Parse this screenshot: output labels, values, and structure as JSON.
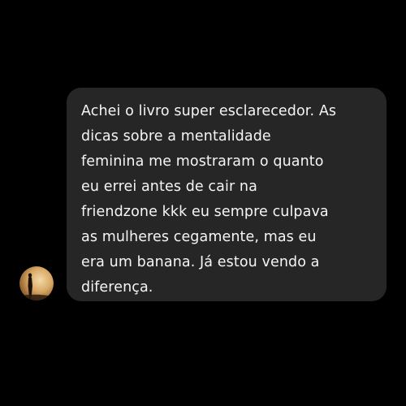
{
  "chat": {
    "avatar_icon": "user-avatar-silhouette-sunset",
    "bubble_color": "#262626",
    "background_color": "#000000",
    "text_color": "#f5f5f5",
    "message": {
      "text": "Achei o livro super esclarecedor. As\ndicas sobre a mentalidade\nfeminina me mostraram o quanto\neu errei antes de cair na\nfriendzone kkk eu sempre culpava\nas mulheres cegamente, mas eu\nera um banana. Já estou vendo a\ndiferença."
    }
  }
}
